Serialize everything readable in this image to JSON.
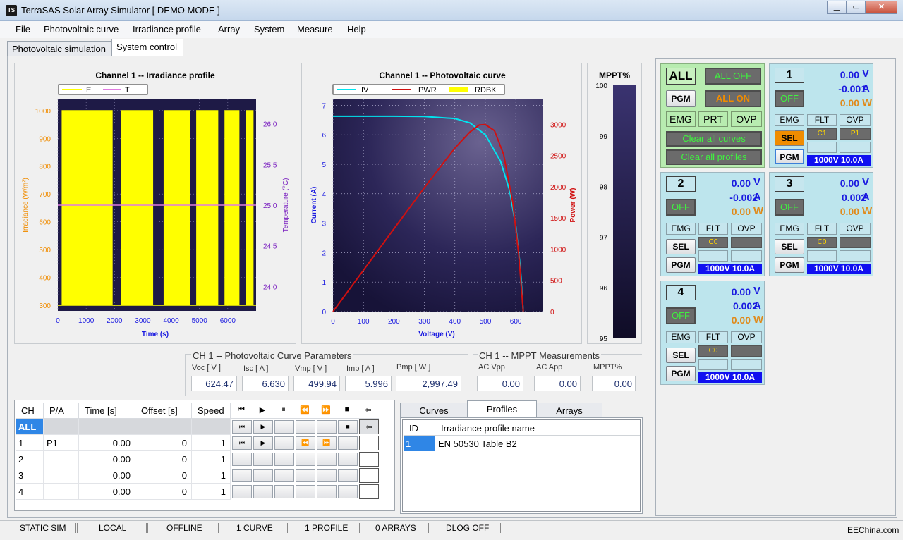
{
  "window": {
    "title": "TerraSAS Solar Array Simulator  [ DEMO MODE ]",
    "icon_text": "TS"
  },
  "menu": [
    "File",
    "Photovoltaic curve",
    "Irradiance profile",
    "Array",
    "System",
    "Measure",
    "Help"
  ],
  "tabs": [
    "Photovoltaic simulation",
    "System control"
  ],
  "active_tab": "System control",
  "charts": {
    "irr_title": "Channel 1 -- Irradiance profile",
    "irr_legend": [
      "E",
      "T"
    ],
    "irr_xlabel": "Time (s)",
    "irr_ylabel": "Irradiance (W/m²)",
    "irr_y2label": "Temperature (°C)",
    "irr_xticks": [
      "0",
      "1000",
      "2000",
      "3000",
      "4000",
      "5000",
      "6000"
    ],
    "irr_yticks": [
      "1000",
      "900",
      "800",
      "700",
      "600",
      "500",
      "400",
      "300"
    ],
    "irr_y2ticks": [
      "26.0",
      "25.5",
      "25.0",
      "24.5",
      "24.0"
    ],
    "pv_title": "Channel 1 -- Photovoltaic curve",
    "pv_legend": [
      "IV",
      "PWR",
      "RDBK"
    ],
    "pv_xlabel": "Voltage (V)",
    "pv_ylabel": "Current (A)",
    "pv_y2label": "Power (W)",
    "pv_xticks": [
      "0",
      "100",
      "200",
      "300",
      "400",
      "500",
      "600"
    ],
    "pv_yticks": [
      "7",
      "6",
      "5",
      "4",
      "3",
      "2",
      "1",
      "0"
    ],
    "pv_y2ticks": [
      "3000",
      "2500",
      "2000",
      "1500",
      "1000",
      "500",
      "0"
    ],
    "mppt_title": "MPPT%",
    "mppt_ticks": [
      "100",
      "99",
      "98",
      "97",
      "96",
      "95"
    ]
  },
  "chart_data": [
    {
      "type": "line",
      "title": "",
      "xlabel": "Time (s)",
      "ylabel": "Irradiance (W/m²)",
      "y2label": "Temperature (°C)",
      "xlim": [
        0,
        7000
      ],
      "ylim": [
        280,
        1040
      ],
      "y2lim": [
        23.7,
        26.3
      ],
      "series": [
        {
          "axis": "y",
          "pattern": "square wave 300↔1000 W/m² in bursts",
          "bursts": [
            [
              150,
              1950
            ],
            [
              2250,
              3350
            ],
            [
              3750,
              4650
            ],
            [
              4900,
              5650
            ],
            [
              5900,
              6400
            ],
            [
              6650,
              6900
            ]
          ],
          "low": 300,
          "high": 1000
        },
        {
          "axis": "y2",
          "x": [
            0,
            7000
          ],
          "y": [
            25.0,
            25.0
          ]
        }
      ],
      "grid": true,
      "legend": "top-left"
    },
    {
      "type": "line",
      "title": "",
      "xlabel": "Voltage (V)",
      "ylabel": "Current (A)",
      "y2label": "Power (W)",
      "xlim": [
        0,
        690
      ],
      "ylim": [
        0,
        7.2
      ],
      "y2lim": [
        0,
        3400
      ],
      "series": [
        {
          "axis": "y",
          "x": [
            0,
            100,
            200,
            300,
            400,
            450,
            500,
            550,
            580,
            600,
            615,
            624.47
          ],
          "y": [
            6.63,
            6.63,
            6.63,
            6.62,
            6.55,
            6.4,
            6.0,
            5.1,
            4.1,
            2.9,
            1.5,
            0
          ]
        },
        {
          "axis": "y2",
          "x": [
            0,
            100,
            200,
            300,
            400,
            450,
            480,
            499.94,
            530,
            560,
            590,
            610,
            624.47
          ],
          "y": [
            0,
            663,
            1326,
            1986,
            2620,
            2880,
            2990,
            2997,
            2900,
            2520,
            1750,
            900,
            0
          ]
        }
      ],
      "grid": true,
      "legend": "top-left"
    },
    {
      "type": "bar",
      "title": "",
      "ylim": [
        95,
        100
      ],
      "values": [
        100
      ],
      "ticks": [
        100,
        99,
        98,
        97,
        96,
        95
      ]
    }
  ],
  "params": {
    "title": "CH 1 -- Photovoltaic Curve Parameters",
    "labels": [
      "Voc [ V ]",
      "Isc [ A ]",
      "Vmp [ V ]",
      "Imp [ A ]",
      "Pmp [ W ]"
    ],
    "values": [
      "624.47",
      "6.630",
      "499.94",
      "5.996",
      "2,997.49"
    ]
  },
  "mppt": {
    "title": "CH 1 -- MPPT Measurements",
    "labels": [
      "AC Vpp",
      "AC App",
      "MPPT%"
    ],
    "values": [
      "0.00",
      "0.00",
      "0.00"
    ]
  },
  "table": {
    "headers": [
      "CH",
      "P/A",
      "Time [s]",
      "Offset [s]",
      "Speed"
    ],
    "header_icons": [
      "⏮",
      "▶",
      "⏸",
      "⏪",
      "⏩",
      "■",
      "⇦"
    ],
    "rows": [
      {
        "ch": "ALL",
        "pa": "",
        "time": "",
        "offset": "",
        "speed": ""
      },
      {
        "ch": "1",
        "pa": "P1",
        "time": "0.00",
        "offset": "0",
        "speed": "1"
      },
      {
        "ch": "2",
        "pa": "",
        "time": "0.00",
        "offset": "0",
        "speed": "1"
      },
      {
        "ch": "3",
        "pa": "",
        "time": "0.00",
        "offset": "0",
        "speed": "1"
      },
      {
        "ch": "4",
        "pa": "",
        "time": "0.00",
        "offset": "0",
        "speed": "1"
      }
    ]
  },
  "lower_tabs": [
    "Curves",
    "Profiles",
    "Arrays"
  ],
  "lower_active": "Profiles",
  "profiles": {
    "headers": [
      "ID",
      "Irradiance profile  name"
    ],
    "rows": [
      {
        "id": "1",
        "name": "EN 50530 Table B2"
      }
    ]
  },
  "all_panel": {
    "all": "ALL",
    "all_off": "ALL OFF",
    "pgm": "PGM",
    "all_on": "ALL ON",
    "emg": "EMG",
    "prt": "PRT",
    "ovp": "OVP",
    "clear_curves": "Clear all curves",
    "clear_profiles": "Clear all profiles"
  },
  "channels": [
    {
      "num": "1",
      "v": "0.00",
      "a": "-0.001",
      "w": "0.00",
      "state": "OFF",
      "curve": "C1",
      "profile": "P1",
      "spec": "1000V 10.0A"
    },
    {
      "num": "2",
      "v": "0.00",
      "a": "-0.002",
      "w": "0.00",
      "state": "OFF",
      "curve": "C0",
      "profile": "",
      "spec": "1000V 10.0A"
    },
    {
      "num": "3",
      "v": "0.00",
      "a": "0.002",
      "w": "0.00",
      "state": "OFF",
      "curve": "C0",
      "profile": "",
      "spec": "1000V 10.0A"
    },
    {
      "num": "4",
      "v": "0.00",
      "a": "0.002",
      "w": "0.00",
      "state": "OFF",
      "curve": "C0",
      "profile": "",
      "spec": "1000V 10.0A"
    }
  ],
  "units": {
    "v": "V",
    "a": "A",
    "w": "W"
  },
  "ch_labels": {
    "emg": "EMG",
    "flt": "FLT",
    "ovp": "OVP",
    "sel": "SEL",
    "pgm": "PGM"
  },
  "status": [
    "STATIC SIM",
    "LOCAL",
    "OFFLINE",
    "1 CURVE",
    "1 PROFILE",
    "0 ARRAYS",
    "DLOG OFF"
  ],
  "watermark": "EEChina.com",
  "colors": {
    "plot_bg": "#1e1a46",
    "irr": "#ffff00",
    "temp": "#e07ae0",
    "iv": "#00e5f0",
    "pwr": "#d01010",
    "orange": "#f08c00",
    "purple": "#7a1fc0",
    "blue": "#1a1ae0",
    "red": "#d01010"
  }
}
